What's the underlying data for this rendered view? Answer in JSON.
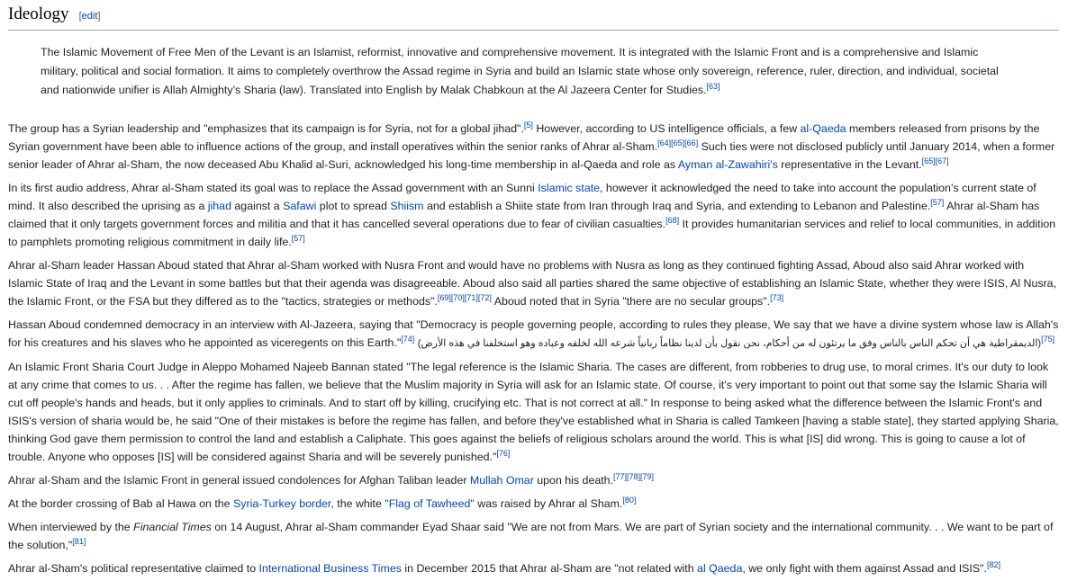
{
  "heading": {
    "title": "Ideology",
    "edit_label": "edit"
  },
  "quote": "The Islamic Movement of Free Men of the Levant is an Islamist, reformist, innovative and comprehensive movement. It is integrated with the Islamic Front and is a comprehensive and Islamic military, political and social formation. It aims to completely overthrow the Assad regime in Syria and build an Islamic state whose only sovereign, reference, ruler, direction, and individual, societal and nationwide unifier is Allah Almighty’s Sharia (law). Translated into English by Malak Chabkoun at the Al Jazeera Center for Studies.",
  "quote_ref": "[63]",
  "p1": {
    "t1": "The group has a Syrian leadership and \"emphasizes that its campaign is for Syria, not for a global jihad\".",
    "r1": "[5]",
    "t2": " However, according to US intelligence officials, a few ",
    "l1": "al-Qaeda",
    "t3": " members released from prisons by the Syrian government have been able to influence actions of the group, and install operatives within the senior ranks of Ahrar al-Sham.",
    "r2": "[64][65][66]",
    "t4": " Such ties were not disclosed publicly until January 2014, when a former senior leader of Ahrar al-Sham, the now deceased Abu Khalid al-Suri, acknowledged his long-time membership in al-Qaeda and role as ",
    "l2": "Ayman al-Zawahiri's",
    "t5": " representative in the Levant.",
    "r3": "[65][67]"
  },
  "p2": {
    "t1": "In its first audio address, Ahrar al-Sham stated its goal was to replace the Assad government with an Sunni ",
    "l1": "Islamic state",
    "t2": ", however it acknowledged the need to take into account the population’s current state of mind. It also described the uprising as a ",
    "l2": "jihad",
    "t3": " against a ",
    "l3": "Safawi",
    "t4": " plot to spread ",
    "l4": "Shiism",
    "t5": " and establish a Shiite state from Iran through Iraq and Syria, and extending to Lebanon and Palestine.",
    "r1": "[57]",
    "t6": " Ahrar al-Sham has claimed that it only targets government forces and militia and that it has cancelled several operations due to fear of civilian casualties.",
    "r2": "[68]",
    "t7": " It provides humanitarian services and relief to local communities, in addition to pamphlets promoting religious commitment in daily life.",
    "r3": "[57]"
  },
  "p3": {
    "t1": "Ahrar al-Sham leader Hassan Aboud stated that Ahrar al-Sham worked with Nusra Front and would have no problems with Nusra as long as they continued fighting Assad, Aboud also said Ahrar worked with Islamic State of Iraq and the Levant in some battles but that their agenda was disagreeable. Aboud also said all parties shared the same objective of establishing an Islamic State, whether they were ISIS, Al Nusra, the Islamic Front, or the FSA but they differed as to the \"tactics, strategies or methods\".",
    "r1": "[69][70][71][72]",
    "t2": " Aboud noted that in Syria \"there are no secular groups\".",
    "r2": "[73]"
  },
  "p4": {
    "t1": "Hassan Aboud condemned democracy in an interview with Al-Jazeera, saying that \"Democracy is people governing people, according to rules they please, We say that we have a divine system whose law is Allah's for his creatures and his slaves who he appointed as viceregents on this Earth.\"",
    "r1": "[74]",
    "arabic": "(الديمقراطية هي أن تحكم الناس بالناس وفق ما يرتئون له من أحكام، نحن نقول بأن لدينا نظاماً ربانياً شرعه الله لخلقه وعباده وهو استخلفنا في هذه الأرض)",
    "r2": "[75]"
  },
  "p5": {
    "t1": "An Islamic Front Sharia Court Judge in Aleppo Mohamed Najeeb Bannan stated \"The legal reference is the Islamic Sharia. The cases are different, from robberies to drug use, to moral crimes. It's our duty to look at any crime that comes to us. . . After the regime has fallen, we believe that the Muslim majority in Syria will ask for an Islamic state. Of course, it's very important to point out that some say the Islamic Sharia will cut off people's hands and heads, but it only applies to criminals. And to start off by killing, crucifying etc. That is not correct at all.\" In response to being asked what the difference between the Islamic Front's and ISIS's version of sharia would be, he said \"One of their mistakes is before the regime has fallen, and before they've established what in Sharia is called Tamkeen [having a stable state], they started applying Sharia, thinking God gave them permission to control the land and establish a Caliphate. This goes against the beliefs of religious scholars around the world. This is what [IS] did wrong. This is going to cause a lot of trouble. Anyone who opposes [IS] will be considered against Sharia and will be severely punished.\"",
    "r1": "[76]"
  },
  "p6": {
    "t1": "Ahrar al-Sham and the Islamic Front in general issued condolences for Afghan Taliban leader ",
    "l1": "Mullah Omar",
    "t2": " upon his death.",
    "r1": "[77][78][79]"
  },
  "p7": {
    "t1": "At the border crossing of Bab al Hawa on the ",
    "l1": "Syria-Turkey border",
    "t2": ", the white ",
    "l2": "\"Flag of Tawheed\"",
    "t3": " was raised by Ahrar al Sham.",
    "r1": "[80]"
  },
  "p8": {
    "t1": "When interviewed by the ",
    "em": "Financial Times",
    "t2": " on 14 August, Ahrar al-Sham commander Eyad Shaar said \"We are not from Mars. We are part of Syrian society and the international community. . . We want to be part of the solution,\"",
    "r1": "[81]"
  },
  "p9": {
    "t1": "Ahrar al-Sham's political representative claimed to ",
    "l1": "International Business Times",
    "t2": " in December 2015 that Ahrar al-Sham are \"not related with ",
    "l2": "al Qaeda",
    "t3": ", we only fight with them against Assad and ISIS\".",
    "r1": "[82]"
  },
  "colors": {
    "link": "#0645ad",
    "text": "#222222",
    "rule": "#a2a9b1"
  }
}
